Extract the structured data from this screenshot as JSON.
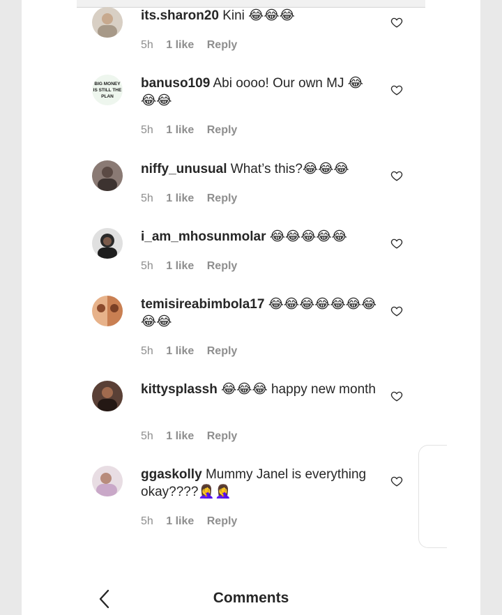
{
  "header": {
    "title": "Comments"
  },
  "comments": [
    {
      "username": "its.sharon20",
      "text": "Kini 😂😂😂",
      "time": "5h",
      "likes": "1 like",
      "reply": "Reply",
      "avatar_color": "#c9b8a6"
    },
    {
      "username": "banuso109",
      "text": "Abi oooo! Our own MJ 😂😂😂",
      "time": "5h",
      "likes": "1 like",
      "reply": "Reply",
      "avatar_color": "#e6f1e6",
      "avatar_text": "BIG MONEY IS STILL THE PLAN"
    },
    {
      "username": "niffy_unusual",
      "text": "What’s this?😂😂😂",
      "time": "5h",
      "likes": "1 like",
      "reply": "Reply",
      "avatar_color": "#6d5d57"
    },
    {
      "username": "i_am_mhosunmolar",
      "text": "😂😂😂😂😂",
      "time": "5h",
      "likes": "1 like",
      "reply": "Reply",
      "avatar_color": "#3a3a3a"
    },
    {
      "username": "temisireabimbola17",
      "text": "😂😂😂😂😂😂😂😂😂",
      "time": "5h",
      "likes": "1 like",
      "reply": "Reply",
      "avatar_color": "#d99a6c"
    },
    {
      "username": "kittysplassh",
      "text": "😂😂😂 happy new month",
      "time": "5h",
      "likes": "1 like",
      "reply": "Reply",
      "avatar_color": "#3b2a24"
    },
    {
      "username": "ggaskolly",
      "text": "Mummy Janel is everything okay????🤦‍♀️🤦‍♀️",
      "time": "5h",
      "likes": "1 like",
      "reply": "Reply",
      "avatar_color": "#bba7b5"
    }
  ],
  "icons": {
    "heart": "heart-outline-icon",
    "back": "chevron-left-icon"
  }
}
